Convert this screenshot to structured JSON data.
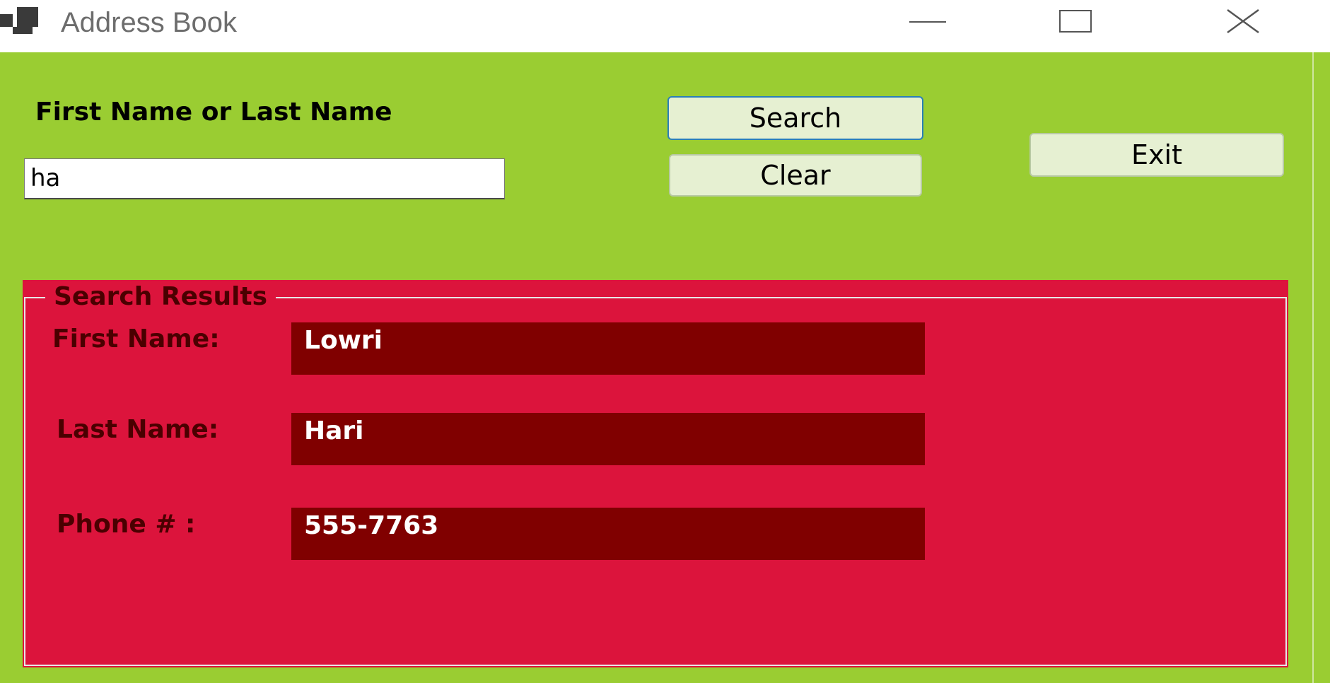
{
  "window": {
    "title": "Address Book",
    "icon": "app-window-icon",
    "controls": [
      "minimize-icon",
      "maximize-icon",
      "close-icon"
    ]
  },
  "search": {
    "label": "First Name or Last Name",
    "value": "ha",
    "search_button": "Search",
    "clear_button": "Clear",
    "exit_button": "Exit"
  },
  "results": {
    "group_title": "Search Results",
    "first_name_label": "First Name:",
    "first_name_value": "Lowri",
    "last_name_label": "Last Name:",
    "last_name_value": "Hari",
    "phone_label": "Phone # :",
    "phone_value": "555-7763"
  },
  "colors": {
    "form_background": "#9acd32",
    "results_background": "#dc143c",
    "value_background": "#800000",
    "button_background": "#e6f0d2"
  }
}
